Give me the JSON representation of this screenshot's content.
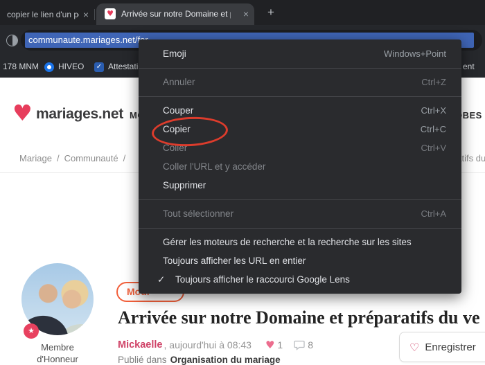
{
  "glyphs": {
    "heart": "♥",
    "heart_outline": "♡",
    "star": "★",
    "check": "✓",
    "close": "×",
    "plus": "+"
  },
  "colors": {
    "accent_pink": "#e73d5c",
    "selection_blue": "#3f65b6",
    "menu_bg": "#2a2b2e",
    "annotation_red": "#dd3c2c",
    "badge_orange": "#f25f3a"
  },
  "browser": {
    "tabs": [
      {
        "title": "copier le lien d'un po"
      },
      {
        "title": "Arrivée sur notre Domaine et pr"
      }
    ],
    "address": {
      "url_selected": "communaute.mariages.net/for"
    },
    "bookmarks": [
      {
        "label": "178 MNM"
      },
      {
        "label": "HIVEO"
      },
      {
        "label": "Attestatio"
      },
      {
        "label": "ent"
      }
    ]
  },
  "context_menu": {
    "items": [
      {
        "label": "Emoji",
        "shortcut": "Windows+Point"
      },
      {
        "label": "Annuler",
        "shortcut": "Ctrl+Z"
      },
      {
        "label": "Couper",
        "shortcut": "Ctrl+X"
      },
      {
        "label": "Copier",
        "shortcut": "Ctrl+C"
      },
      {
        "label": "Coller",
        "shortcut": "Ctrl+V"
      },
      {
        "label": "Coller l'URL et y accéder",
        "shortcut": ""
      },
      {
        "label": "Supprimer",
        "shortcut": ""
      },
      {
        "label": "Tout sélectionner",
        "shortcut": "Ctrl+A"
      },
      {
        "label": "Gérer les moteurs de recherche et la recherche sur les sites",
        "shortcut": ""
      },
      {
        "label": "Toujours afficher les URL en entier",
        "shortcut": ""
      },
      {
        "label": "Toujours afficher le raccourci Google Lens",
        "shortcut": ""
      }
    ]
  },
  "site": {
    "logo_text": "mariages.net",
    "nav_left_fragment": "MO",
    "nav_right_fragment": "OBES",
    "breadcrumb": {
      "items": [
        "Mariage",
        "Communauté"
      ],
      "separator": "/",
      "right_fragment": "ratifs du"
    },
    "member": {
      "line1": "Membre",
      "line2": "d'Honneur"
    },
    "badge_fragment": "Modi",
    "post": {
      "title": "Arrivée sur notre Domaine et préparatifs du ve",
      "author": "Mickaelle",
      "meta": ", aujourd'hui à 08:43",
      "likes": "1",
      "comments": "8",
      "published_prefix": "Publié dans",
      "category": "Organisation du mariage"
    },
    "save_button_label": "Enregistrer"
  }
}
